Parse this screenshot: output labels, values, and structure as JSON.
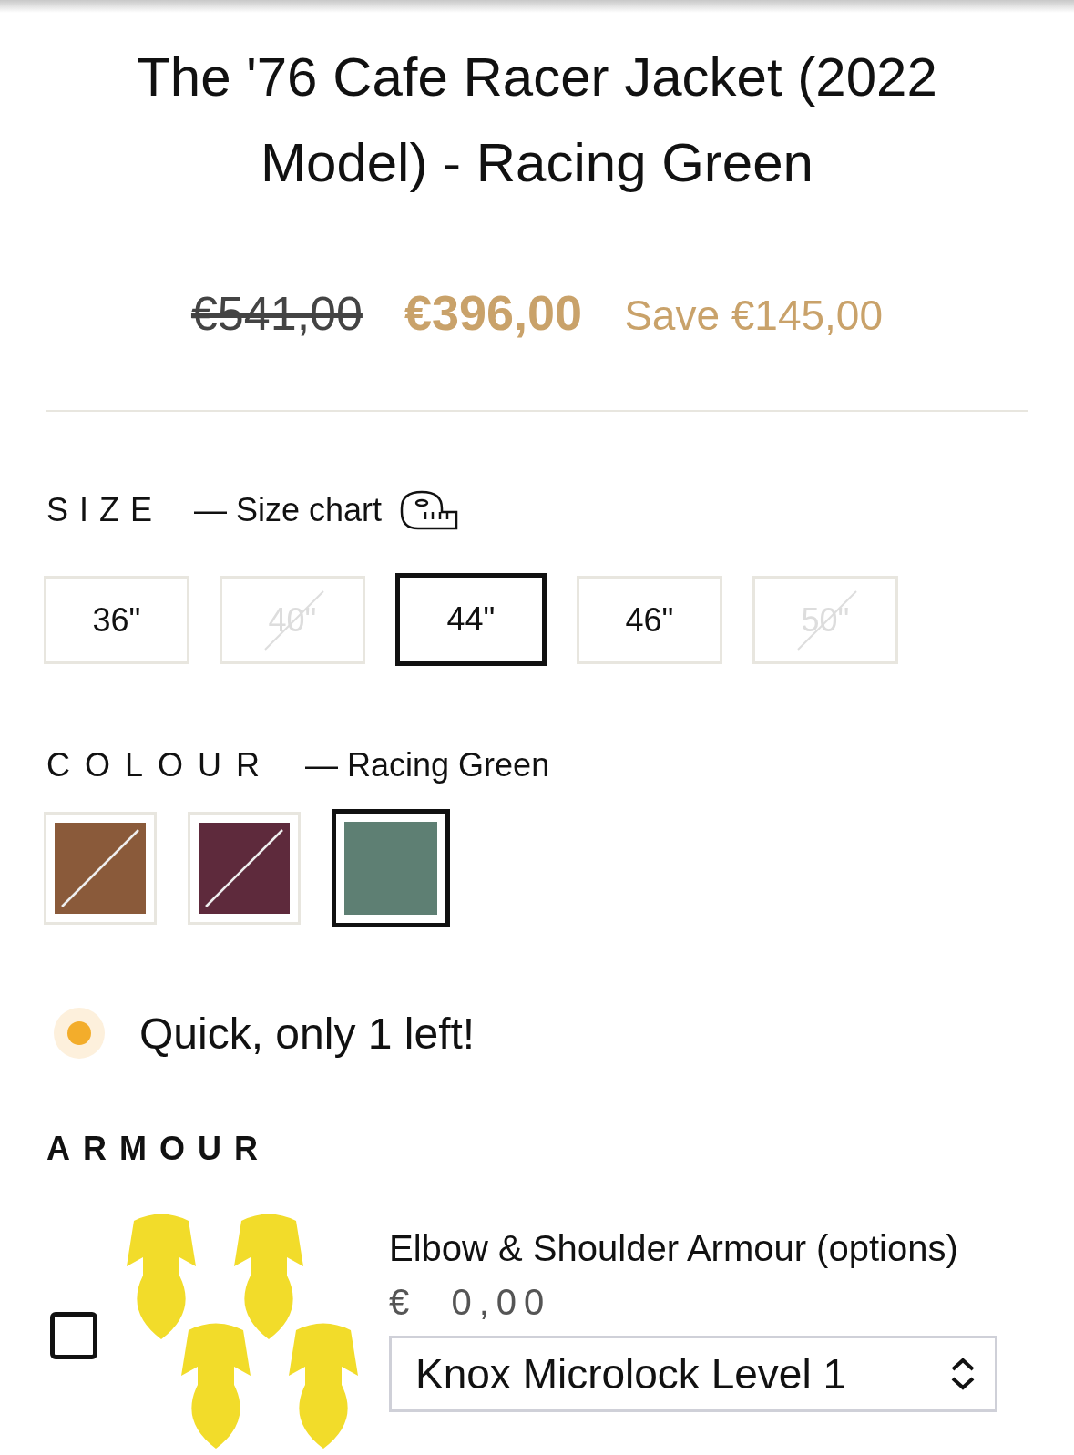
{
  "product": {
    "title": "The '76 Cafe Racer Jacket (2022 Model) - Racing Green"
  },
  "price": {
    "original": "€541,00",
    "sale": "€396,00",
    "saving": "Save €145,00"
  },
  "size": {
    "label": "SIZE",
    "link": "— Size chart",
    "options": [
      {
        "label": "36\"",
        "selected": false,
        "disabled": false
      },
      {
        "label": "40\"",
        "selected": false,
        "disabled": true
      },
      {
        "label": "44\"",
        "selected": true,
        "disabled": false
      },
      {
        "label": "46\"",
        "selected": false,
        "disabled": false
      },
      {
        "label": "50\"",
        "selected": false,
        "disabled": true
      }
    ]
  },
  "colour": {
    "label": "COLOUR",
    "value": "— Racing Green",
    "options": [
      {
        "color": "#8a5a3a",
        "selected": false,
        "disabled": true
      },
      {
        "color": "#5e2a3c",
        "selected": false,
        "disabled": true
      },
      {
        "color": "#5e7f73",
        "selected": true,
        "disabled": false
      }
    ]
  },
  "stock": {
    "text": "Quick, only 1 left!"
  },
  "armour": {
    "label": "ARMOUR",
    "item": {
      "checked": false,
      "name": "Elbow & Shoulder Armour (options)",
      "price": "€  0,00",
      "select": "Knox Microlock Level 1"
    }
  }
}
